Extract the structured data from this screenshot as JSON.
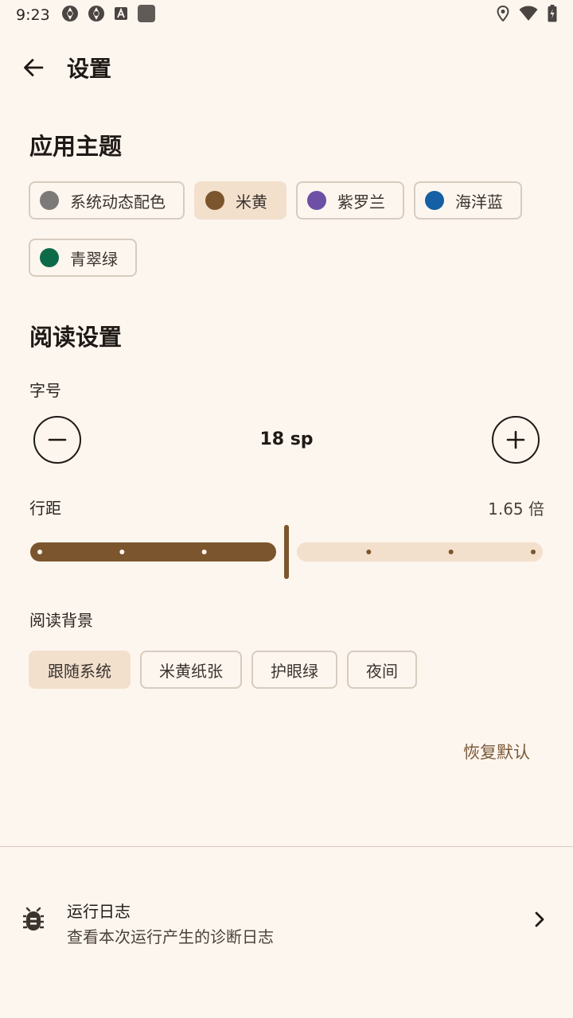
{
  "status_bar": {
    "time": "9:23",
    "left_icons": [
      "aperture-icon",
      "aperture-icon",
      "text-a-icon",
      "square-icon"
    ],
    "right_icons": [
      "location-icon",
      "wifi-icon",
      "battery-icon"
    ]
  },
  "app_bar": {
    "title": "设置"
  },
  "theme": {
    "heading": "应用主题",
    "options": [
      {
        "label": "系统动态配色",
        "color": "#7c7a79",
        "selected": false
      },
      {
        "label": "米黄",
        "color": "#7b552d",
        "selected": true
      },
      {
        "label": "紫罗兰",
        "color": "#6d4fa6",
        "selected": false
      },
      {
        "label": "海洋蓝",
        "color": "#155fa4",
        "selected": false
      },
      {
        "label": "青翠绿",
        "color": "#0d6a48",
        "selected": false
      }
    ]
  },
  "reading": {
    "heading": "阅读设置",
    "font_size": {
      "label": "字号",
      "value": "18 sp"
    },
    "line_spacing": {
      "label": "行距",
      "value": "1.65 倍",
      "fraction": 0.5,
      "steps": 6
    },
    "background": {
      "label": "阅读背景",
      "options": [
        {
          "label": "跟随系统",
          "selected": true
        },
        {
          "label": "米黄纸张",
          "selected": false
        },
        {
          "label": "护眼绿",
          "selected": false
        },
        {
          "label": "夜间",
          "selected": false
        }
      ]
    },
    "reset_label": "恢复默认"
  },
  "logs": {
    "title": "运行日志",
    "subtitle": "查看本次运行产生的诊断日志"
  },
  "colors": {
    "accent": "#7b552d",
    "accent_light": "#f2e0cd",
    "background": "#fdf6ef"
  }
}
